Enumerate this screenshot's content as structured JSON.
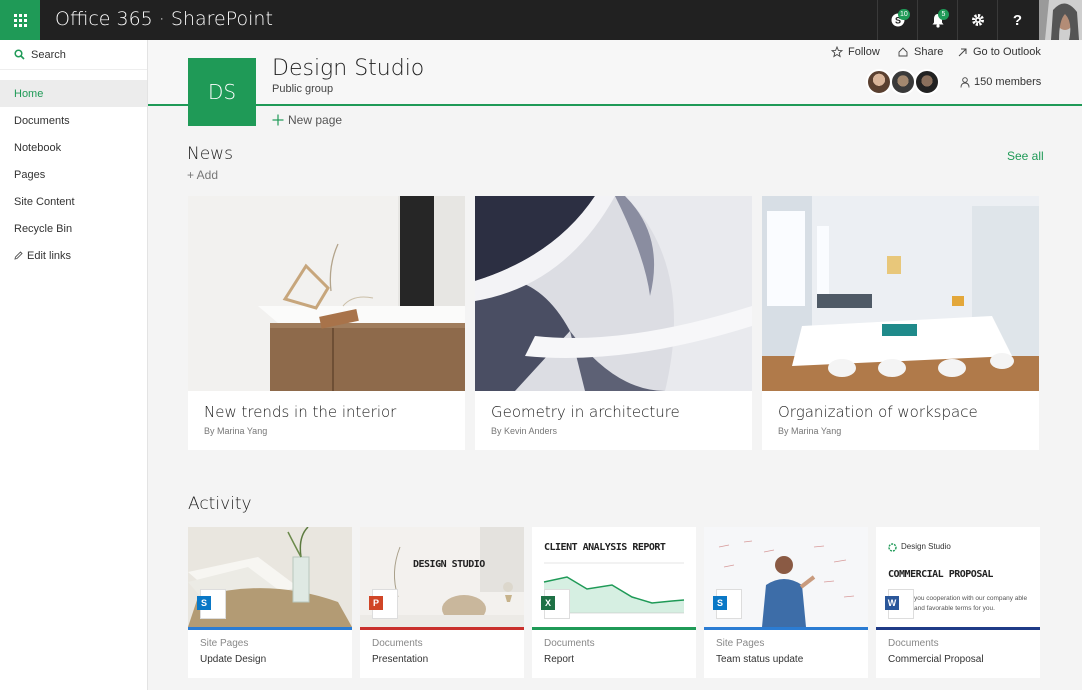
{
  "app": {
    "title": "Office 365 · SharePoint"
  },
  "topbar": {
    "skype_badge": "10",
    "notifications_badge": "5",
    "help_label": "?"
  },
  "sidebar": {
    "search_label": "Search",
    "items": [
      {
        "label": "Home"
      },
      {
        "label": "Documents"
      },
      {
        "label": "Notebook"
      },
      {
        "label": "Pages"
      },
      {
        "label": "Site Content"
      },
      {
        "label": "Recycle Bin"
      },
      {
        "label": "Edit links"
      }
    ]
  },
  "site": {
    "initials": "DS",
    "title": "Design Studio",
    "subtitle": "Public group",
    "follow_label": "Follow",
    "share_label": "Share",
    "outlook_label": "Go to Outlook",
    "members_label": "150 members",
    "new_page_label": "New page"
  },
  "news": {
    "title": "News",
    "add_label": "+ Add",
    "see_all_label": "See all",
    "cards": [
      {
        "title": "New trends in the interior",
        "author": "By Marina Yang"
      },
      {
        "title": "Geometry in architecture",
        "author": "By Kevin Anders"
      },
      {
        "title": "Organization of workspace",
        "author": "By Marina Yang"
      }
    ]
  },
  "activity": {
    "title": "Activity",
    "cards": [
      {
        "type": "Site Pages",
        "name": "Update Design",
        "accent": "#2b7cd3",
        "app": "S",
        "app_color": "#0a78c6"
      },
      {
        "type": "Documents",
        "name": "Presentation",
        "accent": "#c9302c",
        "app": "P",
        "app_color": "#d04526",
        "heading": "DESIGN STUDIO"
      },
      {
        "type": "Documents",
        "name": "Report",
        "accent": "#1f9a57",
        "app": "X",
        "app_color": "#1e7145",
        "heading": "CLIENT ANALYSIS REPORT"
      },
      {
        "type": "Site Pages",
        "name": "Team status update",
        "accent": "#2b7cd3",
        "app": "S",
        "app_color": "#0a78c6"
      },
      {
        "type": "Documents",
        "name": "Commercial Proposal",
        "accent": "#1f3b87",
        "app": "W",
        "app_color": "#2b579a",
        "heading": "COMMERCIAL PROPOSAL",
        "brand": "Design Studio",
        "body": "you cooperation with our company able and favorable terms for you."
      }
    ]
  },
  "colors": {
    "brand": "#1f9a57",
    "topbar": "#212121"
  }
}
